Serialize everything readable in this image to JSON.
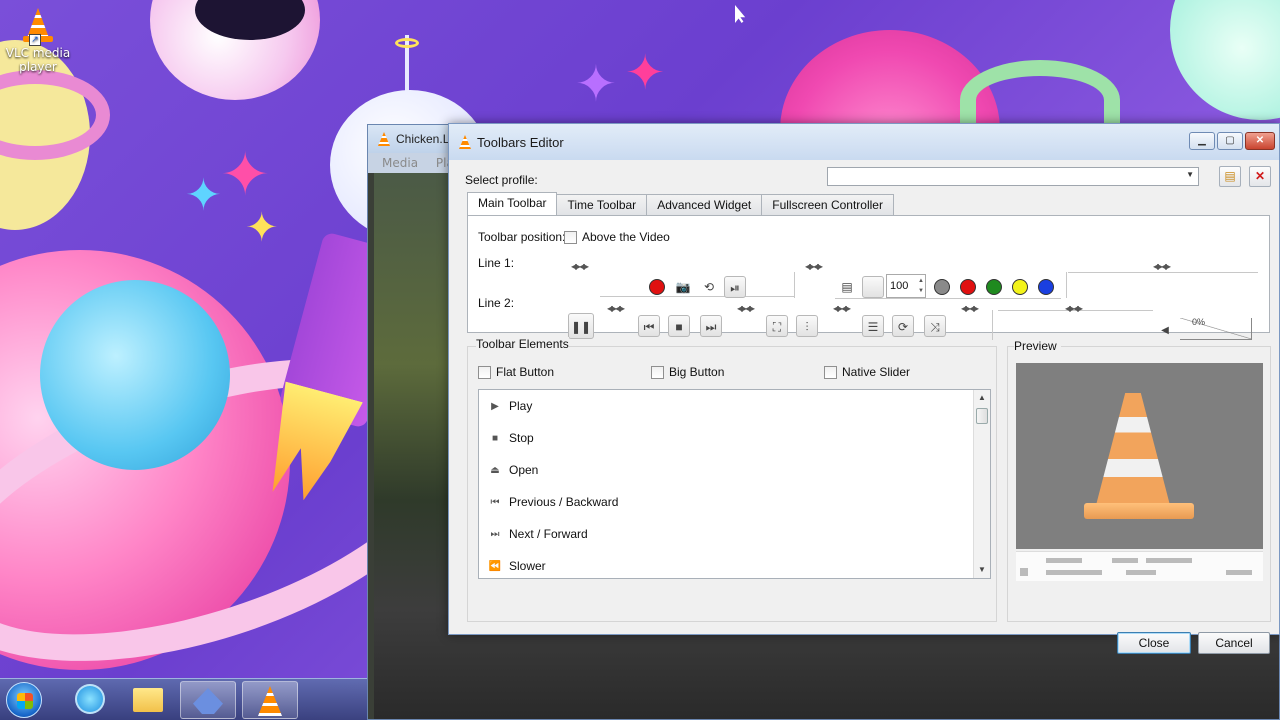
{
  "desktop": {
    "icon_label_line1": "VLC media",
    "icon_label_line2": "player"
  },
  "background_window": {
    "title": "Chicken.L",
    "menu": [
      "Media",
      "Pla"
    ]
  },
  "dialog": {
    "title": "Toolbars Editor",
    "select_profile_label": "Select profile:",
    "select_profile_value": "",
    "tabs": [
      {
        "label": "Main Toolbar",
        "active": true
      },
      {
        "label": "Time Toolbar",
        "active": false
      },
      {
        "label": "Advanced Widget",
        "active": false
      },
      {
        "label": "Fullscreen Controller",
        "active": false
      }
    ],
    "toolbar_position_label": "Toolbar position:",
    "above_video_label": "Above the Video",
    "line1_label": "Line 1:",
    "line2_label": "Line 2:",
    "speed_value": "100",
    "volume_percent": "0%",
    "colors": {
      "record_red": "#e01010",
      "dot_gray": "#8a8a8a",
      "dot_red": "#e01010",
      "dot_green": "#1f8a1f",
      "dot_yellow": "#f3f31a",
      "dot_blue": "#1a3fe0"
    },
    "toolbar_elements": {
      "title": "Toolbar Elements",
      "flat_button": "Flat Button",
      "big_button": "Big Button",
      "native_slider": "Native Slider",
      "items": [
        {
          "icon": "play-icon",
          "glyph": "▶",
          "label": "Play"
        },
        {
          "icon": "stop-icon",
          "glyph": "■",
          "label": "Stop"
        },
        {
          "icon": "eject-icon",
          "glyph": "⏏",
          "label": "Open"
        },
        {
          "icon": "previous-icon",
          "glyph": "⏮",
          "label": "Previous / Backward"
        },
        {
          "icon": "next-icon",
          "glyph": "⏭",
          "label": "Next / Forward"
        },
        {
          "icon": "slower-icon",
          "glyph": "⏪",
          "label": "Slower"
        }
      ]
    },
    "preview_title": "Preview",
    "close_button": "Close",
    "cancel_button": "Cancel"
  }
}
